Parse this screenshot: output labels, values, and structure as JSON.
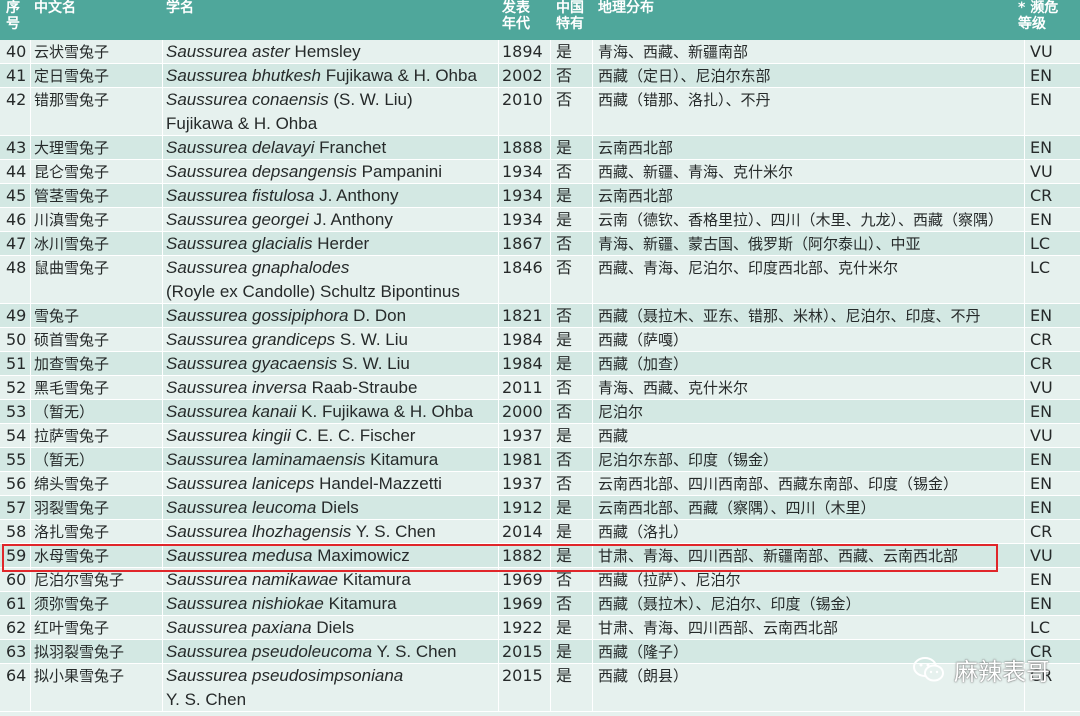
{
  "headers": {
    "no": "序\n号",
    "cn": "中文名",
    "sci": "学名",
    "year": "发表\n年代",
    "endemic": "中国\n特有",
    "dist": "地理分布",
    "status": "* 濒危\n等级"
  },
  "rows": [
    {
      "no": "40",
      "cn": "云状雪兔子",
      "genus": "Saussurea",
      "epithet": "aster",
      "author": "Hemsley",
      "author2": "",
      "year": "1894",
      "endemic": "是",
      "dist": "青海、西藏、新疆南部",
      "status": "VU"
    },
    {
      "no": "41",
      "cn": "定日雪兔子",
      "genus": "Saussurea",
      "epithet": "bhutkesh",
      "author": "Fujikawa & H. Ohba",
      "author2": "",
      "year": "2002",
      "endemic": "否",
      "dist": "西藏（定日）、尼泊尔东部",
      "status": "EN"
    },
    {
      "no": "42",
      "cn": "错那雪兔子",
      "genus": "Saussurea",
      "epithet": "conaensis",
      "author": "(S. W. Liu)",
      "author2": "Fujikawa & H. Ohba",
      "year": "2010",
      "endemic": "否",
      "dist": "西藏（错那、洛扎）、不丹",
      "status": "EN"
    },
    {
      "no": "43",
      "cn": "大理雪兔子",
      "genus": "Saussurea",
      "epithet": "delavayi",
      "author": "Franchet",
      "author2": "",
      "year": "1888",
      "endemic": "是",
      "dist": "云南西北部",
      "status": "EN"
    },
    {
      "no": "44",
      "cn": "昆仑雪兔子",
      "genus": "Saussurea",
      "epithet": "depsangensis",
      "author": "Pampanini",
      "author2": "",
      "year": "1934",
      "endemic": "否",
      "dist": "西藏、新疆、青海、克什米尔",
      "status": "VU"
    },
    {
      "no": "45",
      "cn": "管茎雪兔子",
      "genus": "Saussurea",
      "epithet": "fistulosa",
      "author": "J. Anthony",
      "author2": "",
      "year": "1934",
      "endemic": "是",
      "dist": "云南西北部",
      "status": "CR"
    },
    {
      "no": "46",
      "cn": "川滇雪兔子",
      "genus": "Saussurea",
      "epithet": "georgei",
      "author": "J. Anthony",
      "author2": "",
      "year": "1934",
      "endemic": "是",
      "dist": "云南（德钦、香格里拉）、四川（木里、九龙）、西藏（察隅）",
      "status": "EN"
    },
    {
      "no": "47",
      "cn": "冰川雪兔子",
      "genus": "Saussurea",
      "epithet": "glacialis",
      "author": "Herder",
      "author2": "",
      "year": "1867",
      "endemic": "否",
      "dist": "青海、新疆、蒙古国、俄罗斯（阿尔泰山）、中亚",
      "status": "LC"
    },
    {
      "no": "48",
      "cn": "鼠曲雪兔子",
      "genus": "Saussurea",
      "epithet": "gnaphalodes",
      "author": "",
      "author2": "(Royle ex Candolle) Schultz Bipontinus",
      "year": "1846",
      "endemic": "否",
      "dist": "西藏、青海、尼泊尔、印度西北部、克什米尔",
      "status": "LC"
    },
    {
      "no": "49",
      "cn": "雪兔子",
      "genus": "Saussurea",
      "epithet": "gossipiphora",
      "author": "D. Don",
      "author2": "",
      "year": "1821",
      "endemic": "否",
      "dist": "西藏（聂拉木、亚东、错那、米林）、尼泊尔、印度、不丹",
      "status": "EN"
    },
    {
      "no": "50",
      "cn": "硕首雪兔子",
      "genus": "Saussurea",
      "epithet": "grandiceps",
      "author": "S. W. Liu",
      "author2": "",
      "year": "1984",
      "endemic": "是",
      "dist": "西藏（萨嘎）",
      "status": "CR"
    },
    {
      "no": "51",
      "cn": "加查雪兔子",
      "genus": "Saussurea",
      "epithet": "gyacaensis",
      "author": "S. W. Liu",
      "author2": "",
      "year": "1984",
      "endemic": "是",
      "dist": "西藏（加查）",
      "status": "CR"
    },
    {
      "no": "52",
      "cn": "黑毛雪兔子",
      "genus": "Saussurea",
      "epithet": "inversa",
      "author": "Raab-Straube",
      "author2": "",
      "year": "2011",
      "endemic": "否",
      "dist": "青海、西藏、克什米尔",
      "status": "VU"
    },
    {
      "no": "53",
      "cn": "（暂无）",
      "genus": "Saussurea",
      "epithet": "kanaii",
      "author": "K. Fujikawa & H. Ohba",
      "author2": "",
      "year": "2000",
      "endemic": "否",
      "dist": "尼泊尔",
      "status": "EN"
    },
    {
      "no": "54",
      "cn": "拉萨雪兔子",
      "genus": "Saussurea",
      "epithet": "kingii",
      "author": "C. E. C. Fischer",
      "author2": "",
      "year": "1937",
      "endemic": "是",
      "dist": "西藏",
      "status": "VU"
    },
    {
      "no": "55",
      "cn": "（暂无）",
      "genus": "Saussurea",
      "epithet": "laminamaensis",
      "author": "Kitamura",
      "author2": "",
      "year": "1981",
      "endemic": "否",
      "dist": "尼泊尔东部、印度（锡金）",
      "status": "EN"
    },
    {
      "no": "56",
      "cn": "绵头雪兔子",
      "genus": "Saussurea",
      "epithet": "laniceps",
      "author": "Handel-Mazzetti",
      "author2": "",
      "year": "1937",
      "endemic": "否",
      "dist": "云南西北部、四川西南部、西藏东南部、印度（锡金）",
      "status": "EN"
    },
    {
      "no": "57",
      "cn": "羽裂雪兔子",
      "genus": "Saussurea",
      "epithet": "leucoma",
      "author": "Diels",
      "author2": "",
      "year": "1912",
      "endemic": "是",
      "dist": "云南西北部、西藏（察隅）、四川（木里）",
      "status": "EN"
    },
    {
      "no": "58",
      "cn": "洛扎雪兔子",
      "genus": "Saussurea",
      "epithet": "lhozhagensis",
      "author": "Y. S. Chen",
      "author2": "",
      "year": "2014",
      "endemic": "是",
      "dist": "西藏（洛扎）",
      "status": "CR"
    },
    {
      "no": "59",
      "cn": "水母雪兔子",
      "genus": "Saussurea",
      "epithet": "medusa",
      "author": "Maximowicz",
      "author2": "",
      "year": "1882",
      "endemic": "是",
      "dist": "甘肃、青海、四川西部、新疆南部、西藏、云南西北部",
      "status": "VU"
    },
    {
      "no": "60",
      "cn": "尼泊尔雪兔子",
      "genus": "Saussurea",
      "epithet": "namikawae",
      "author": "Kitamura",
      "author2": "",
      "year": "1969",
      "endemic": "否",
      "dist": "西藏（拉萨）、尼泊尔",
      "status": "EN"
    },
    {
      "no": "61",
      "cn": "须弥雪兔子",
      "genus": "Saussurea",
      "epithet": "nishiokae",
      "author": "Kitamura",
      "author2": "",
      "year": "1969",
      "endemic": "否",
      "dist": "西藏（聂拉木）、尼泊尔、印度（锡金）",
      "status": "EN"
    },
    {
      "no": "62",
      "cn": "红叶雪兔子",
      "genus": "Saussurea",
      "epithet": "paxiana",
      "author": "Diels",
      "author2": "",
      "year": "1922",
      "endemic": "是",
      "dist": "甘肃、青海、四川西部、云南西北部",
      "status": "LC"
    },
    {
      "no": "63",
      "cn": "拟羽裂雪兔子",
      "genus": "Saussurea",
      "epithet": "pseudoleucoma",
      "author": "Y. S. Chen",
      "author2": "",
      "year": "2015",
      "endemic": "是",
      "dist": "西藏（隆子）",
      "status": "CR"
    },
    {
      "no": "64",
      "cn": "拟小果雪兔子",
      "genus": "Saussurea",
      "epithet": "pseudosimpsoniana",
      "author": "",
      "author2": "Y. S. Chen",
      "year": "2015",
      "endemic": "是",
      "dist": "西藏（朗县）",
      "status": "CR"
    }
  ],
  "watermark": {
    "text": "麻辣表哥",
    "icon": "wechat-icon"
  }
}
